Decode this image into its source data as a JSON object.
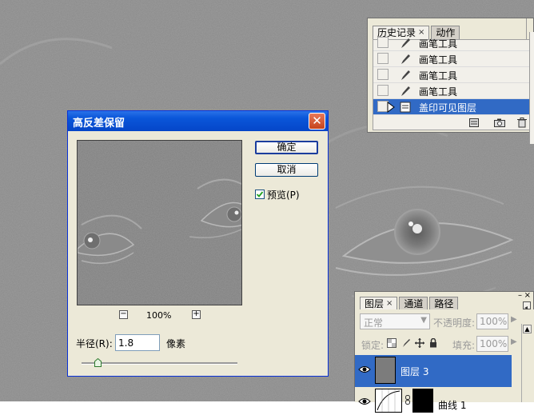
{
  "history_panel": {
    "tabs": [
      {
        "label": "历史记录",
        "closable": true
      },
      {
        "label": "动作",
        "closable": false
      }
    ],
    "items": [
      {
        "label": "画笔工具",
        "icon": "brush-icon",
        "selected": false
      },
      {
        "label": "画笔工具",
        "icon": "brush-icon",
        "selected": false
      },
      {
        "label": "画笔工具",
        "icon": "brush-icon",
        "selected": false
      },
      {
        "label": "画笔工具",
        "icon": "brush-icon",
        "selected": false
      },
      {
        "label": "盖印可见图层",
        "icon": "stamp-layer-icon",
        "selected": true
      }
    ],
    "footer_icons": [
      "new-document-from-state-icon",
      "new-snapshot-icon",
      "trash-icon"
    ]
  },
  "dialog": {
    "title": "高反差保留",
    "ok_label": "确定",
    "cancel_label": "取消",
    "preview_label": "预览(P)",
    "preview_checked": true,
    "zoom_out": "−",
    "zoom_in": "+",
    "zoom_level": "100%",
    "radius_label": "半径(R):",
    "radius_value": "1.8",
    "radius_unit": "像素",
    "slider_fraction": 0.1
  },
  "layers_panel": {
    "tabs": [
      {
        "label": "图层",
        "closable": true
      },
      {
        "label": "通道",
        "closable": false
      },
      {
        "label": "路径",
        "closable": false
      }
    ],
    "blend_mode": "正常",
    "opacity_label": "不透明度:",
    "opacity_value": "100%",
    "lock_label": "锁定:",
    "fill_label": "填充:",
    "fill_value": "100%",
    "layers": [
      {
        "name": "图层 3",
        "selected": true
      },
      {
        "name": "曲线 1",
        "selected": false
      }
    ]
  },
  "colors": {
    "selection": "#316ac5",
    "titlebar": "#0a56d9",
    "panel": "#ece9d8"
  }
}
